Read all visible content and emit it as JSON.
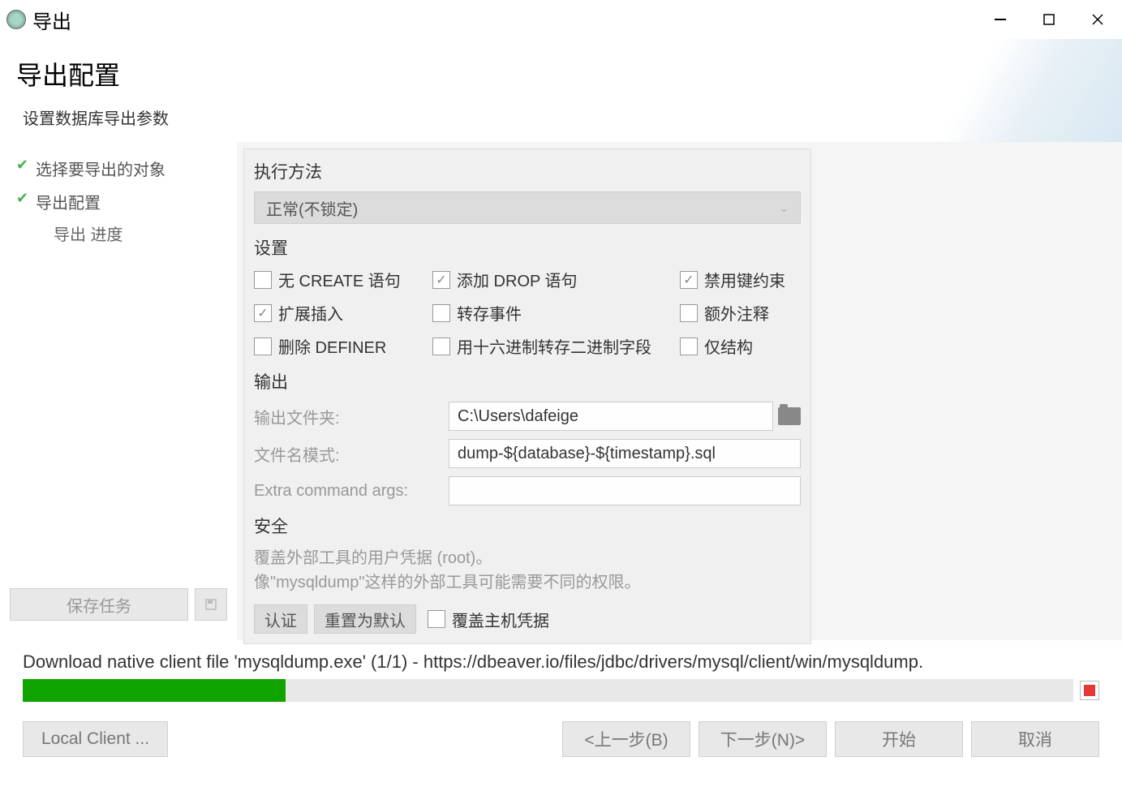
{
  "window": {
    "title": "导出"
  },
  "header": {
    "title": "导出配置",
    "subtitle": "设置数据库导出参数"
  },
  "sidebar": {
    "items": [
      {
        "label": "选择要导出的对象",
        "done": true
      },
      {
        "label": "导出配置",
        "done": true,
        "sub": "导出 进度"
      }
    ],
    "save_task": "保存任务"
  },
  "content": {
    "method": {
      "label": "执行方法",
      "selected": "正常(不锁定)"
    },
    "settings": {
      "label": "设置",
      "checks": [
        {
          "label": "无 CREATE 语句",
          "checked": false
        },
        {
          "label": "添加 DROP 语句",
          "checked": true
        },
        {
          "label": "禁用键约束",
          "checked": true
        },
        {
          "label": "扩展插入",
          "checked": true
        },
        {
          "label": "转存事件",
          "checked": false
        },
        {
          "label": "额外注释",
          "checked": false
        },
        {
          "label": "删除 DEFINER",
          "checked": false
        },
        {
          "label": "用十六进制转存二进制字段",
          "checked": false
        },
        {
          "label": "仅结构",
          "checked": false
        }
      ]
    },
    "output": {
      "label": "输出",
      "folder_label": "输出文件夹:",
      "folder_value": "C:\\Users\\dafeige",
      "pattern_label": "文件名模式:",
      "pattern_value": "dump-${database}-${timestamp}.sql",
      "extra_label": "Extra command args:",
      "extra_value": ""
    },
    "security": {
      "label": "安全",
      "note1": "覆盖外部工具的用户凭据 (root)。",
      "note2": "像\"mysqldump\"这样的外部工具可能需要不同的权限。",
      "auth_btn": "认证",
      "reset_btn": "重置为默认",
      "override_label": "覆盖主机凭据",
      "override_checked": false
    }
  },
  "download": {
    "text": "Download native client file 'mysqldump.exe' (1/1) - https://dbeaver.io/files/jdbc/drivers/mysql/client/win/mysqldump.",
    "progress_percent": 25
  },
  "footer": {
    "local_client": "Local Client ...",
    "back": "<上一步(B)",
    "next": "下一步(N)>",
    "start": "开始",
    "cancel": "取消"
  }
}
